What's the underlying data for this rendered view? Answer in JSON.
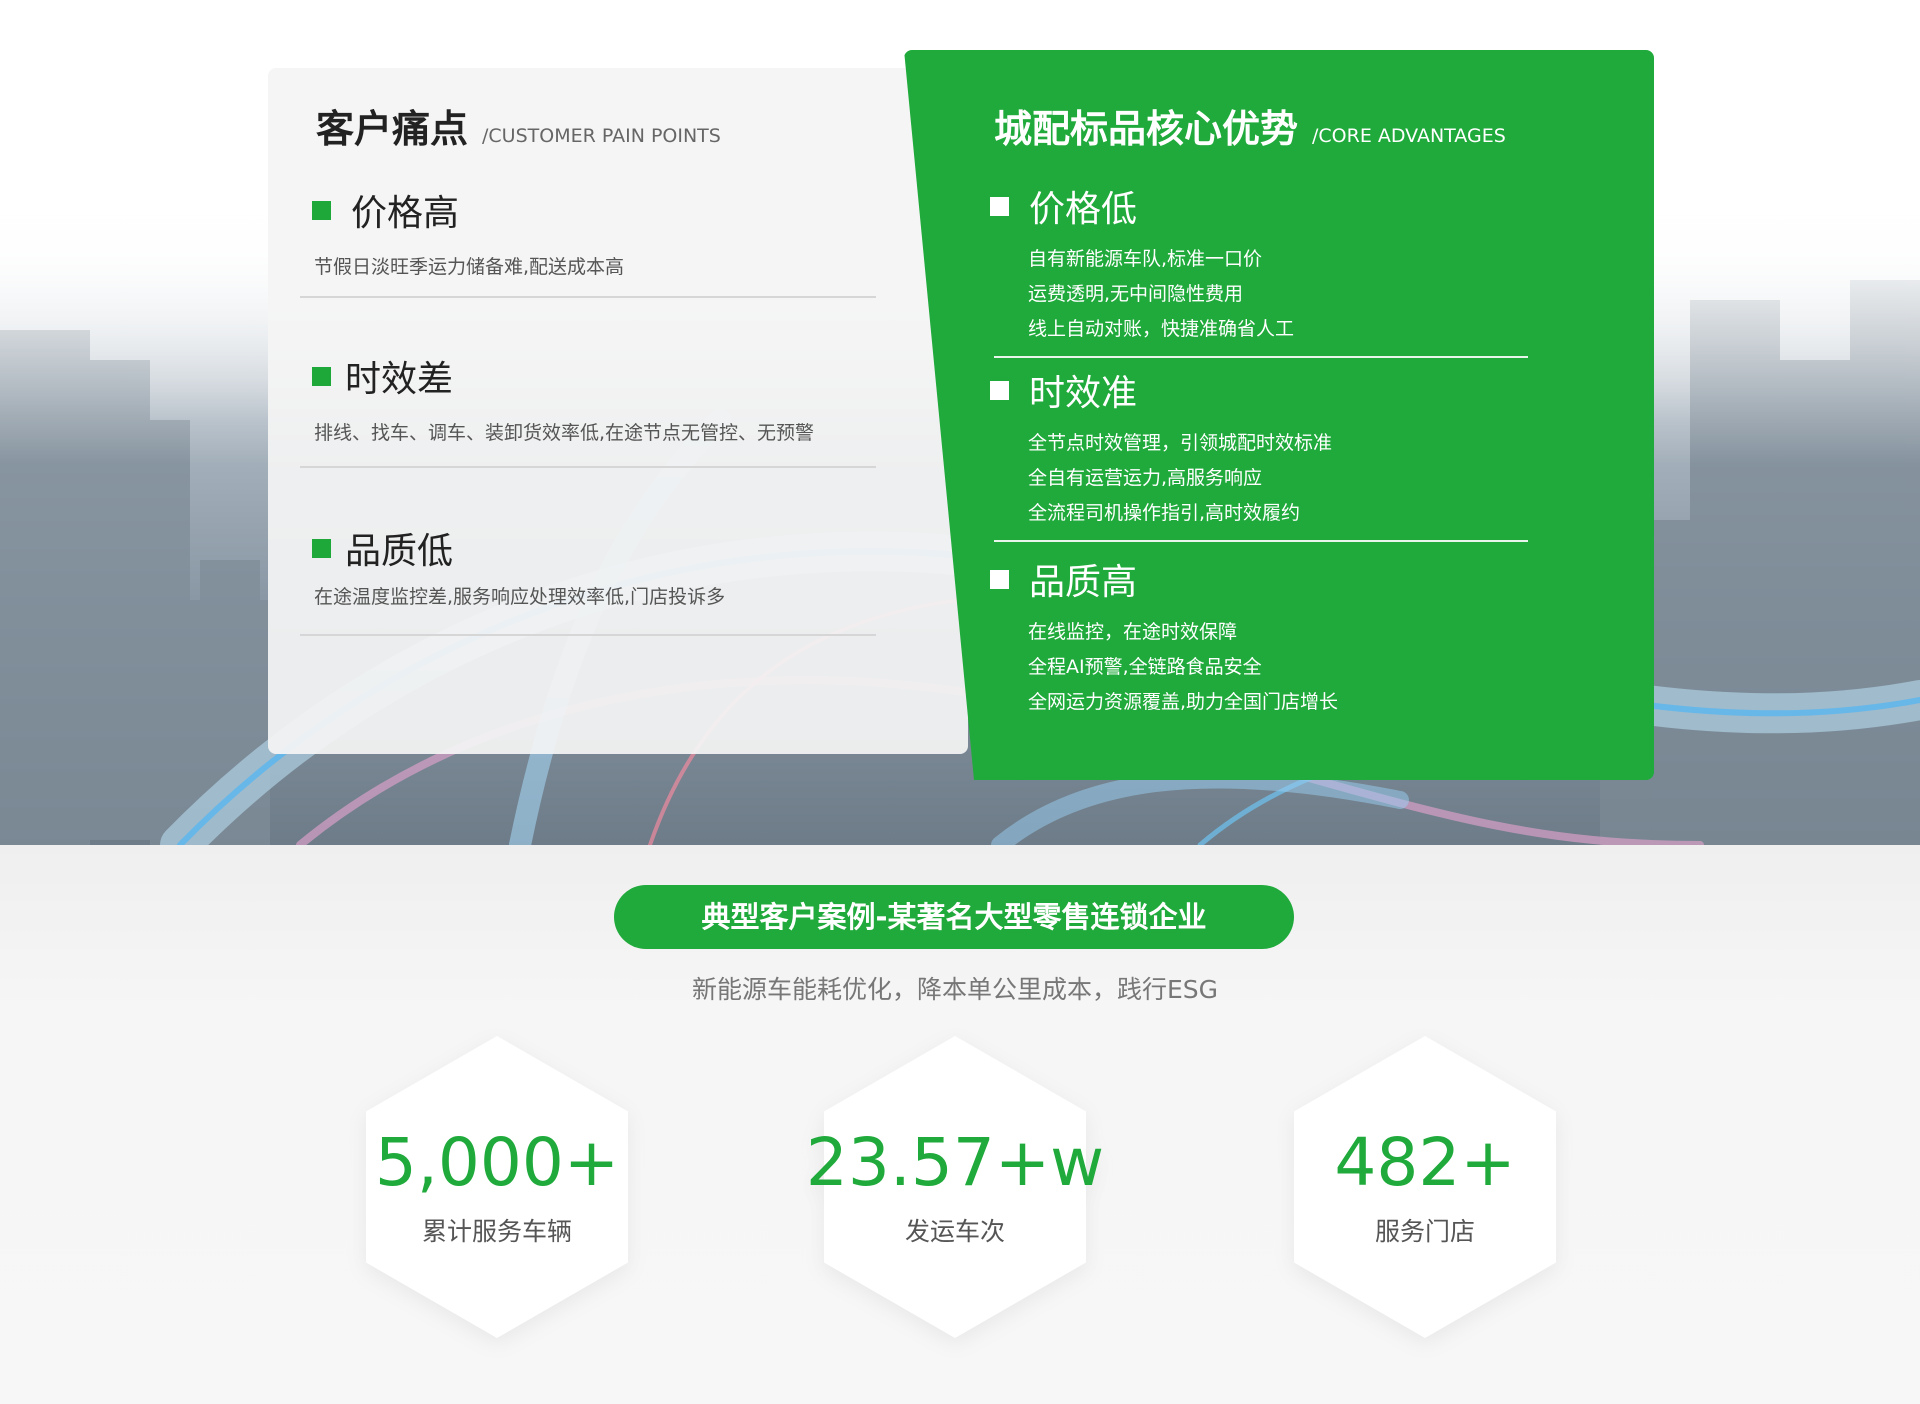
{
  "pain": {
    "title": "客户痛点",
    "title_en": "/CUSTOMER PAIN POINTS",
    "items": [
      {
        "label": "价格高",
        "desc": "节假日淡旺季运力储备难,配送成本高"
      },
      {
        "label": "时效差",
        "desc": "排线、找车、调车、装卸货效率低,在途节点无管控、无预警"
      },
      {
        "label": "品质低",
        "desc": "在途温度监控差,服务响应处理效率低,门店投诉多"
      }
    ]
  },
  "advantages": {
    "title": "城配标品核心优势",
    "title_en": "/CORE ADVANTAGES",
    "items": [
      {
        "label": "价格低",
        "lines": [
          "自有新能源车队,标准一口价",
          "运费透明,无中间隐性费用",
          "线上自动对账，快捷准确省人工"
        ]
      },
      {
        "label": "时效准",
        "lines": [
          "全节点时效管理，引领城配时效标准",
          "全自有运营运力,高服务响应",
          "全流程司机操作指引,高时效履约"
        ]
      },
      {
        "label": "品质高",
        "lines": [
          "在线监控，在途时效保障",
          "全程AI预警,全链路食品安全",
          "全网运力资源覆盖,助力全国门店增长"
        ]
      }
    ]
  },
  "case": {
    "title": "典型客户案例-某著名大型零售连锁企业",
    "subtitle": "新能源车能耗优化，降本单公里成本，践行ESG",
    "stats": [
      {
        "value": "5,000+",
        "label": "累计服务车辆"
      },
      {
        "value": "23.57+w",
        "label": "发运车次"
      },
      {
        "value": "482+",
        "label": "服务门店"
      }
    ]
  },
  "colors": {
    "accent": "#1faa3b"
  }
}
